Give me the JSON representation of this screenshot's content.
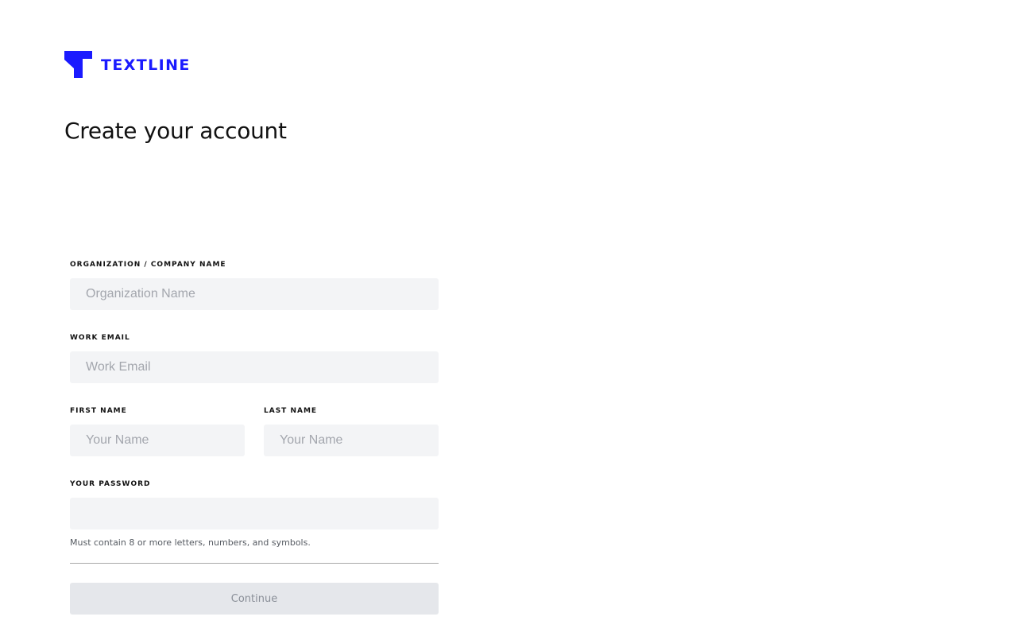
{
  "brand": {
    "name": "TEXTLINE",
    "color": "#1a1aff"
  },
  "header": {
    "title": "Create your account"
  },
  "form": {
    "organization": {
      "label": "ORGANIZATION / COMPANY NAME",
      "placeholder": "Organization Name",
      "value": ""
    },
    "work_email": {
      "label": "WORK EMAIL",
      "placeholder": "Work Email",
      "value": ""
    },
    "first_name": {
      "label": "FIRST NAME",
      "placeholder": "Your Name",
      "value": ""
    },
    "last_name": {
      "label": "LAST NAME",
      "placeholder": "Your Name",
      "value": ""
    },
    "password": {
      "label": "YOUR PASSWORD",
      "placeholder": "",
      "value": "",
      "hint": "Must contain 8 or more letters, numbers, and symbols."
    },
    "continue_label": "Continue"
  },
  "icons": {
    "logo": "textline-logo-icon"
  }
}
